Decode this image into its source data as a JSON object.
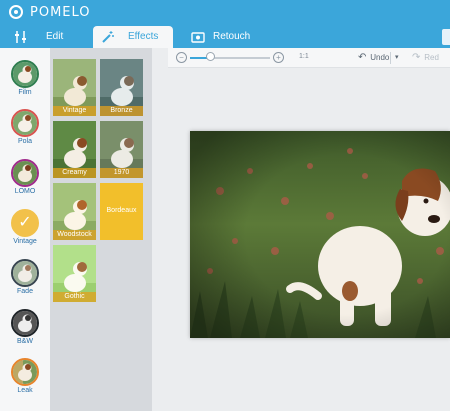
{
  "app": {
    "title": "POMELO"
  },
  "tabs": [
    {
      "label": "Edit",
      "icon": "sliders-icon"
    },
    {
      "label": "Effects",
      "icon": "magic-wand-icon"
    },
    {
      "label": "Retouch",
      "icon": "retouch-icon"
    }
  ],
  "categories": [
    {
      "label": "Film",
      "ring": "#2e7d4f"
    },
    {
      "label": "Pola",
      "ring": "#d9534f"
    },
    {
      "label": "LOMO",
      "ring": "#a02a8c"
    },
    {
      "label": "Vintage",
      "ring": "#f2c14a"
    },
    {
      "label": "Fade",
      "ring": "#37444f"
    },
    {
      "label": "B&W",
      "ring": "#1e2327"
    },
    {
      "label": "Leak",
      "ring": "#e8842b"
    }
  ],
  "effects": [
    {
      "name": "Vintage"
    },
    {
      "name": "Bronze"
    },
    {
      "name": "Creamy"
    },
    {
      "name": "1970"
    },
    {
      "name": "Woodstock"
    },
    {
      "name": "Bordeaux"
    },
    {
      "name": "Gothic"
    }
  ],
  "toolbar": {
    "zoom_level": "1:1",
    "zoom_fraction": 0.25,
    "undo_label": "Undo",
    "redo_label": "Red"
  },
  "colors": {
    "brand": "#3ba6da",
    "accent": "#f2c14a"
  }
}
